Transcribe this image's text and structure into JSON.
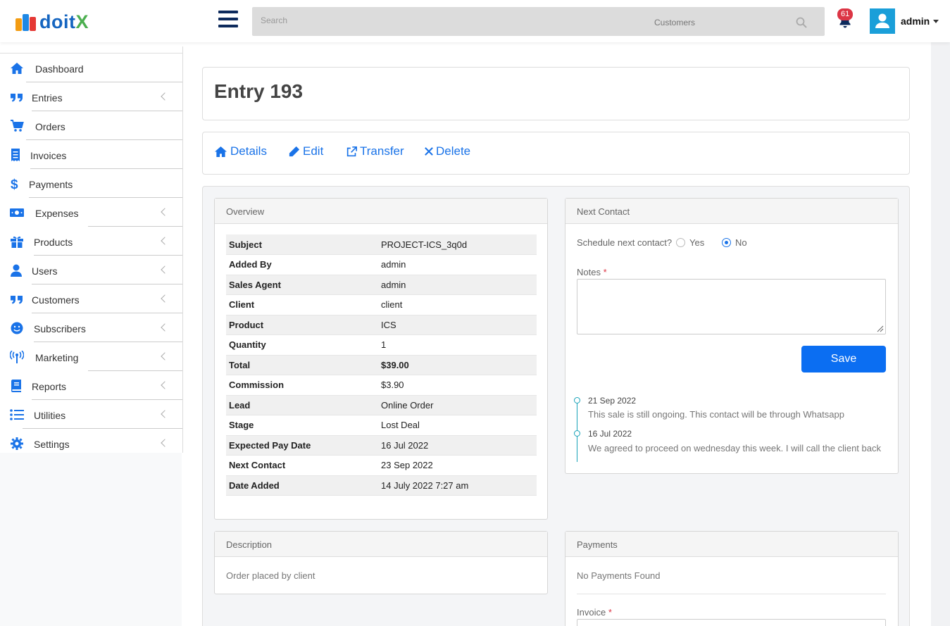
{
  "app": {
    "logo_text_a": "doit",
    "logo_text_b": "X"
  },
  "header": {
    "search_placeholder": "Search",
    "search_scope": "Customers",
    "notification_count": "61",
    "user_name": "admin"
  },
  "sidebar": {
    "items": [
      {
        "label": "Dashboard",
        "icon": "home-icon"
      },
      {
        "label": "Entries",
        "icon": "quote-icon"
      },
      {
        "label": "Orders",
        "icon": "cart-icon"
      },
      {
        "label": "Invoices",
        "icon": "receipt-icon"
      },
      {
        "label": "Payments",
        "icon": "dollar-icon"
      },
      {
        "label": "Expenses",
        "icon": "money-bill-icon"
      },
      {
        "label": "Products",
        "icon": "gift-icon"
      },
      {
        "label": "Users",
        "icon": "user-icon"
      },
      {
        "label": "Customers",
        "icon": "quote-icon"
      },
      {
        "label": "Subscribers",
        "icon": "smile-icon"
      },
      {
        "label": "Marketing",
        "icon": "broadcast-icon"
      },
      {
        "label": "Reports",
        "icon": "book-icon"
      },
      {
        "label": "Utilities",
        "icon": "list-icon"
      },
      {
        "label": "Settings",
        "icon": "gear-icon"
      }
    ]
  },
  "page": {
    "title": "Entry 193"
  },
  "actions": {
    "details": "Details",
    "edit": "Edit",
    "transfer": "Transfer",
    "delete": "Delete"
  },
  "overview": {
    "heading": "Overview",
    "rows": [
      {
        "key": "Subject",
        "value": "PROJECT-ICS_3q0d"
      },
      {
        "key": "Added By",
        "value": "admin"
      },
      {
        "key": "Sales Agent",
        "value": "admin"
      },
      {
        "key": "Client",
        "value": "client"
      },
      {
        "key": "Product",
        "value": "ICS"
      },
      {
        "key": "Quantity",
        "value": "1"
      },
      {
        "key": "Total",
        "value": "$39.00"
      },
      {
        "key": "Commission",
        "value": "$3.90"
      },
      {
        "key": "Lead",
        "value": "Online Order"
      },
      {
        "key": "Stage",
        "value": "Lost Deal"
      },
      {
        "key": "Expected Pay Date",
        "value": "16 Jul 2022"
      },
      {
        "key": "Next Contact",
        "value": "23 Sep 2022"
      },
      {
        "key": "Date Added",
        "value": "14 July 2022 7:27 am"
      }
    ]
  },
  "next_contact": {
    "heading": "Next Contact",
    "schedule_label": "Schedule next contact?",
    "yes_label": "Yes",
    "no_label": "No",
    "selected": "No",
    "notes_label": "Notes",
    "required_mark": "*",
    "save_label": "Save",
    "timeline": [
      {
        "date": "21 Sep 2022",
        "text": "This sale is still ongoing. This contact will be through Whatsapp"
      },
      {
        "date": "16 Jul 2022",
        "text": "We agreed to proceed on wednesday this week. I will call the client back"
      }
    ]
  },
  "description": {
    "heading": "Description",
    "text": "Order placed by client"
  },
  "payments": {
    "heading": "Payments",
    "empty_text": "No Payments Found",
    "invoice_label": "Invoice",
    "required_mark": "*"
  },
  "colors": {
    "accent": "#1a73e8",
    "brand_blue": "#1565c0",
    "brand_green": "#4caf50",
    "badge": "#dc3545",
    "timeline": "#17a2b8"
  }
}
